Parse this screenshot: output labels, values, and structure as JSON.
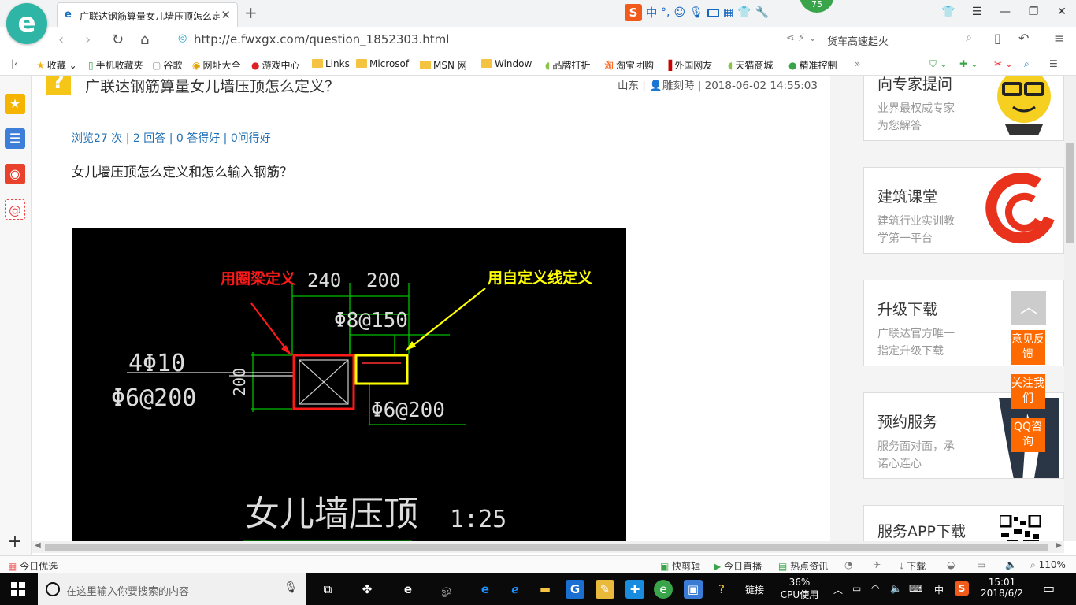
{
  "browser": {
    "tab_title": "广联达钢筋算量女儿墙压顶怎么定义？",
    "url": "http://e.fwxgx.com/question_1852303.html",
    "search_text": "货车高速起火",
    "badge_count": "75",
    "ime_mode": "中",
    "ime_punct": "°,"
  },
  "bookmarks": [
    "收藏",
    "手机收藏夹",
    "谷歌",
    "网址大全",
    "游戏中心",
    "Links",
    "Microsof",
    "MSN 网",
    "Window",
    "品牌打折",
    "淘宝团购",
    "外国网友",
    "天猫商城",
    "精准控制"
  ],
  "question": {
    "title": "广联达钢筋算量女儿墙压顶怎么定义？",
    "location": "山东",
    "author": "雕刻時",
    "datetime": "2018-06-02 14:55:03",
    "stats": "浏览27 次 | 2 回答 | 0 答得好 | 0问得好",
    "body": "女儿墙压顶怎么定义和怎么输入钢筋？"
  },
  "cad": {
    "label_red": "用圈梁定义",
    "label_yellow": "用自定义线定义",
    "dim_240": "240",
    "dim_200_top": "200",
    "dim_200_side": "200",
    "rebar_stirrup": "Φ8@150",
    "rebar_main": "4Φ10",
    "rebar_dist": "Φ6@200",
    "rebar_right": "Φ6@200",
    "caption": "女儿墙压顶",
    "scale": "1:25"
  },
  "ads": [
    {
      "title": "向专家提问",
      "sub1": "业界最权威专家",
      "sub2": "为您解答"
    },
    {
      "title": "建筑课堂",
      "sub1": "建筑行业实训教",
      "sub2": "学第一平台"
    },
    {
      "title": "升级下载",
      "sub1": "广联达官方唯一",
      "sub2": "指定升级下载"
    },
    {
      "title": "预约服务",
      "sub1": "服务面对面，承",
      "sub2": "诺心连心"
    },
    {
      "title": "服务APP下载"
    }
  ],
  "float_buttons": [
    "意见反馈",
    "关注我们",
    "QQ咨询"
  ],
  "statusbar": {
    "left": "今日优选",
    "items": [
      "快剪辑",
      "今日直播",
      "热点资讯",
      "下载"
    ],
    "zoom": "110%"
  },
  "taskbar": {
    "search_placeholder": "在这里输入你要搜索的内容",
    "links": "链接",
    "cpu_percent": "36%",
    "cpu_label": "CPU使用",
    "ime": "中",
    "time": "15:01",
    "date": "2018/6/2"
  },
  "colors": {
    "accent_orange": "#ff6a00",
    "link_blue": "#1f6fb5",
    "cad_red": "#ff1a1a",
    "cad_yellow": "#ffff00",
    "cad_green": "#00c000"
  }
}
